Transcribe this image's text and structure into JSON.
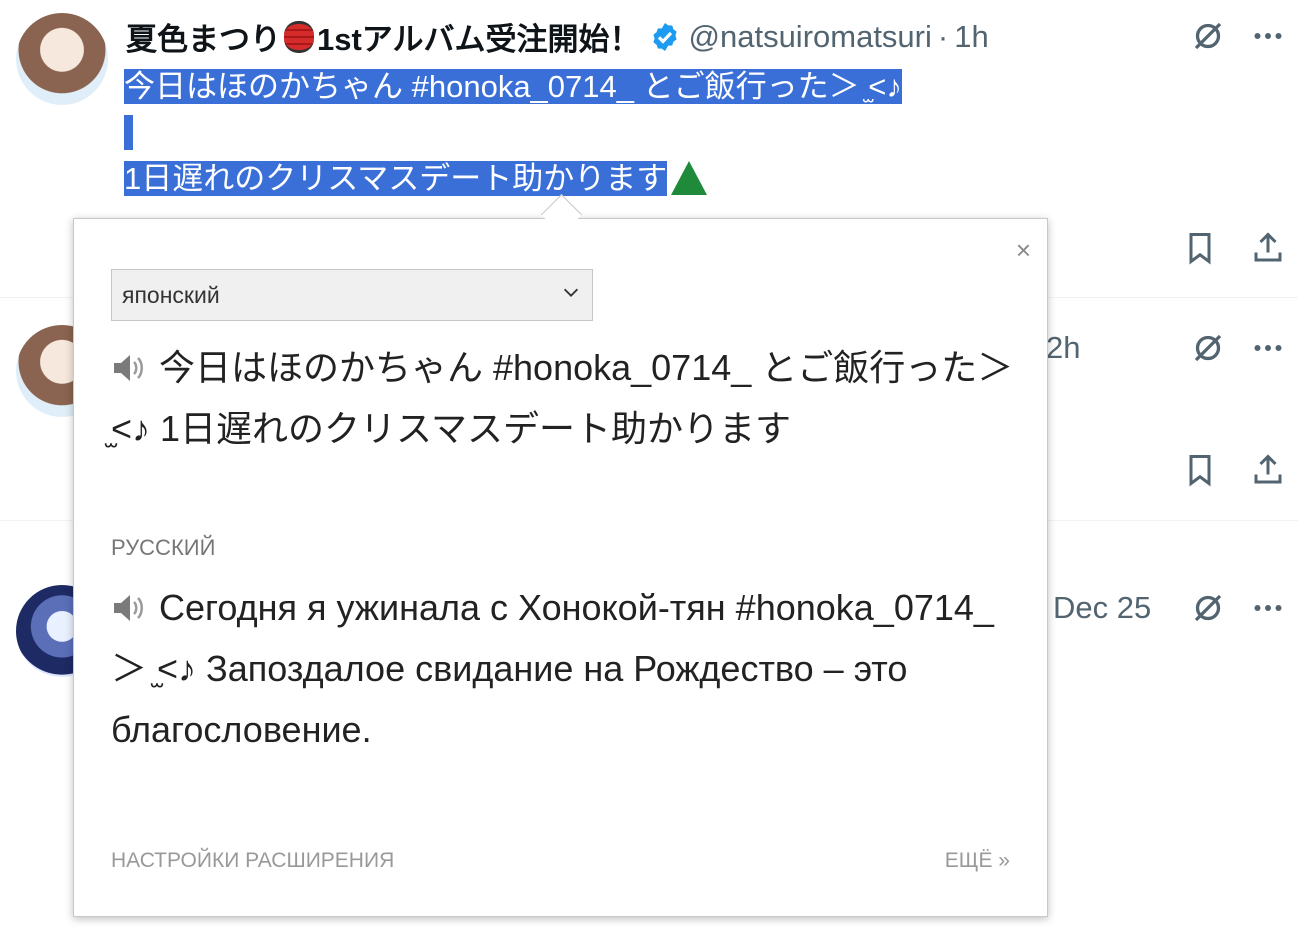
{
  "tweet1": {
    "author_name": "夏色まつり",
    "author_suffix": "1stアルバム受注開始！",
    "handle": "@natsuiromatsuri",
    "separator": "·",
    "time": "1h",
    "text_line1": "今日はほのかちゃん #honoka_0714_ とご飯行った＞ ̫<♪",
    "text_line3": "1日遅れのクリスマスデート助かります"
  },
  "tweet2": {
    "time": "2h"
  },
  "tweet3": {
    "time": "Dec 25"
  },
  "popup": {
    "close_label": "×",
    "source_language": "японский",
    "source_text": "今日はほのかちゃん #honoka_0714_ とご飯行った＞ ̫<♪ 1日遅れのクリスマスデート助かります",
    "target_language_label": "РУССКИЙ",
    "target_text": "Сегодня я ужинала с Хонокой-тян #honoka_0714_ ＞ ̫<♪ Запоздалое свидание на Рождество – это благословение.",
    "settings_link": "НАСТРОЙКИ РАСШИРЕНИЯ",
    "more_link": "ЕЩЁ »"
  },
  "colors": {
    "selection": "#3a6fd8",
    "verified": "#1d9bf0",
    "muted": "#536471"
  },
  "icons": [
    "lantern-icon",
    "verified-icon",
    "grok-icon",
    "more-icon",
    "bookmark-icon",
    "share-icon",
    "speaker-icon",
    "close-icon",
    "chevron-down-icon",
    "christmas-tree-icon"
  ]
}
